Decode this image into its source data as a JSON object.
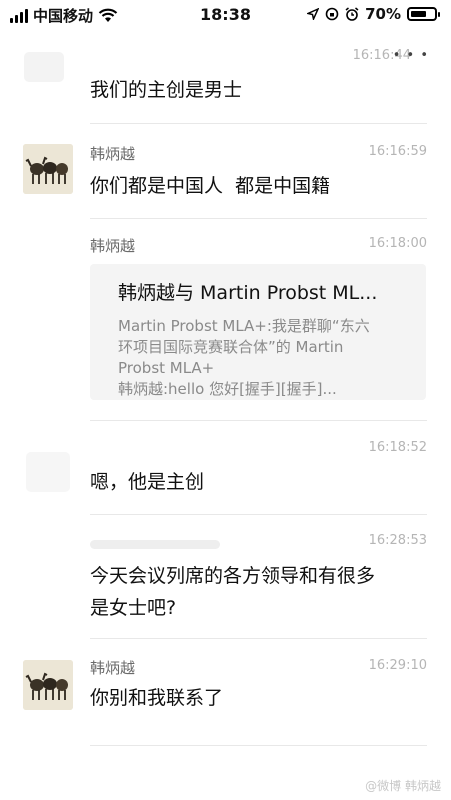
{
  "status_bar": {
    "carrier": "中国移动",
    "time": "18:38",
    "battery": "70%",
    "battery_level": 0.7
  },
  "messages": [
    {
      "time": "16:16:44",
      "text": "我们的主创是男士"
    },
    {
      "sender": "韩炳越",
      "time": "16:16:59",
      "text": "你们都是中国人  都是中国籍"
    },
    {
      "sender": "韩炳越",
      "time": "16:18:00",
      "card": {
        "title": "韩炳越与 Martin Probst ML...",
        "lines": [
          "Martin Probst MLA+:我是群聊“东六",
          "环项目国际竞赛联合体”的 Martin",
          "Probst MLA+",
          "韩炳越:hello  您好[握手][握手]..."
        ]
      }
    },
    {
      "time": "16:18:52",
      "text": "嗯，他是主创"
    },
    {
      "time": "16:28:53",
      "text_lines": [
        "今天会议列席的各方领导和有很多",
        "是女士吧?"
      ]
    },
    {
      "sender": "韩炳越",
      "time": "16:29:10",
      "text": "你别和我联系了"
    }
  ],
  "watermark": "@微博 韩炳越"
}
